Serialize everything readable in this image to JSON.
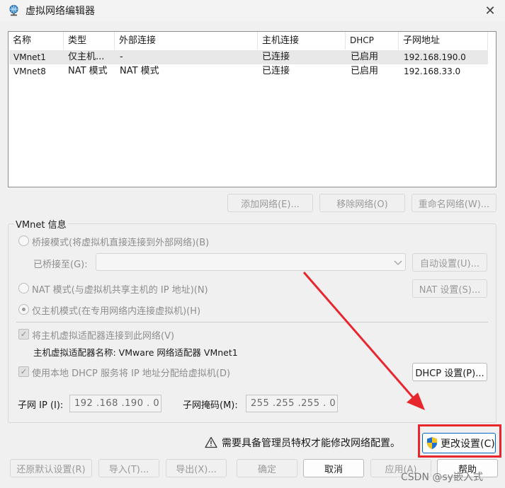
{
  "window": {
    "title": "虚拟网络编辑器",
    "close_glyph": "✕"
  },
  "list": {
    "columns": [
      "名称",
      "类型",
      "外部连接",
      "主机连接",
      "DHCP",
      "子网地址"
    ],
    "rows": [
      [
        "VMnet1",
        "仅主机...",
        "-",
        "已连接",
        "已启用",
        "192.168.190.0"
      ],
      [
        "VMnet8",
        "NAT 模式",
        "NAT 模式",
        "已连接",
        "已启用",
        "192.168.33.0"
      ]
    ],
    "selected_row": 0
  },
  "list_buttons": {
    "add": "添加网络(E)...",
    "remove": "移除网络(O)",
    "rename": "重命名网络(W)..."
  },
  "vmnet_info": {
    "title": "VMnet 信息",
    "bridged_label": "桥接模式(将虚拟机直接连接到外部网络)(B)",
    "bridged_to_label": "已桥接至(G):",
    "auto_settings": "自动设置(U)...",
    "nat_label": "NAT 模式(与虚拟机共享主机的 IP 地址)(N)",
    "nat_settings": "NAT 设置(S)...",
    "hostonly_label": "仅主机模式(在专用网络内连接虚拟机)(H)",
    "connect_adapter_label": "将主机虚拟适配器连接到此网络(V)",
    "adapter_name_label": "主机虚拟适配器名称: VMware 网络适配器 VMnet1",
    "dhcp_label": "使用本地 DHCP 服务将 IP 地址分配给虚拟机(D)",
    "dhcp_settings": "DHCP 设置(P)...",
    "subnet_ip_label": "子网 IP (I):",
    "subnet_ip_value": "192 .168 .190 .  0",
    "subnet_mask_label": "子网掩码(M):",
    "subnet_mask_value": "255 .255 .255 .  0"
  },
  "warning": {
    "text": "需要具备管理员特权才能修改网络配置。",
    "change_settings": "更改设置(C)"
  },
  "footer": {
    "restore": "还原默认设置(R)",
    "import": "导入(T)...",
    "export": "导出(X)...",
    "ok": "确定",
    "cancel": "取消",
    "apply": "应用(A)",
    "help": "帮助"
  },
  "watermark": "CSDN @sy嵌入式",
  "colors": {
    "annotation_red": "#e8262e",
    "shield_blue": "#1f6fd1",
    "shield_yellow": "#f4c31c"
  }
}
